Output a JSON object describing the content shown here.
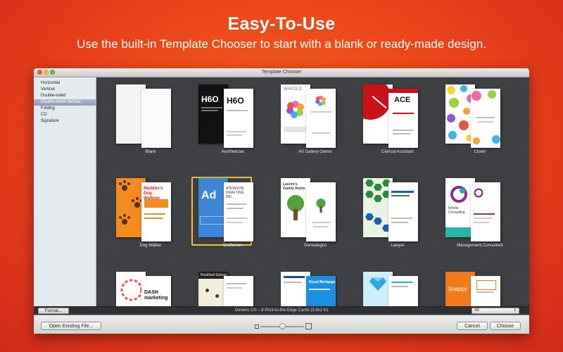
{
  "promo": {
    "headline": "Easy-To-Use",
    "subline": "Use the built-in Template Chooser to start with a blank or ready-made design."
  },
  "window": {
    "title": "Template Chooser"
  },
  "sidebar": {
    "items": [
      {
        "label": "Horizontal"
      },
      {
        "label": "Vertical"
      },
      {
        "label": "Double-sided"
      },
      {
        "label": "Double-sided Vertical",
        "selected": true
      },
      {
        "label": "Folding"
      },
      {
        "label": "CD"
      },
      {
        "label": "Signature"
      }
    ]
  },
  "templates": [
    {
      "name": "Blank"
    },
    {
      "name": "Aesthetician",
      "card_text": "H6O"
    },
    {
      "name": "Art Gallery Owner",
      "card_text": "WAKOLD"
    },
    {
      "name": "Clerical Assistant",
      "card_text": "ACE"
    },
    {
      "name": "Clown"
    },
    {
      "name": "Dog Walker",
      "card_text": "Maddox's Dog Walking"
    },
    {
      "name": "Draftsman",
      "card_text": "Ad",
      "card_text2": "ATKINSON DRAFTING INC.",
      "selected": true
    },
    {
      "name": "Genealogist",
      "card_text": "Lauren's Family Roots"
    },
    {
      "name": "Lawyer"
    },
    {
      "name": "Management Consultant",
      "card_text": "Infinite Consulting"
    },
    {
      "name": "",
      "card_text": "DASH marketing"
    },
    {
      "name": "",
      "card_text": "Rockford School"
    },
    {
      "name": "",
      "card_text": "Royal Mortgage"
    },
    {
      "name": ""
    },
    {
      "name": "",
      "card_text": "Snappy"
    }
  ],
  "bottom_bar": {
    "format_button": "Format...",
    "status": "Generic US – 8 Print-to-the-Edge Cards (3.5x2 in)",
    "filter_value": "All"
  },
  "footer": {
    "open_button": "Open Existing File...",
    "cancel_button": "Cancel",
    "choose_button": "Choose",
    "zoom_level": 0.5
  },
  "colors": {
    "background": "#e8411a",
    "selection": "#e7c23a",
    "sidebar_selected": "#8e9db3"
  }
}
